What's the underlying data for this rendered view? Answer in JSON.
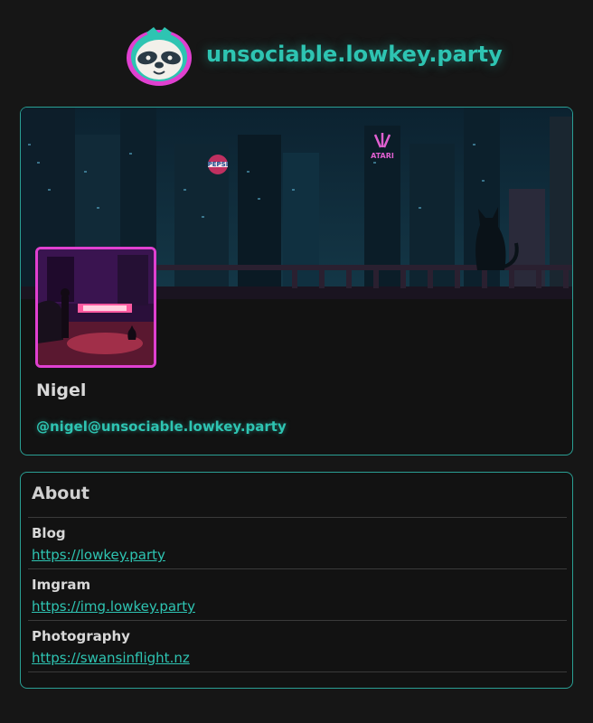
{
  "site": {
    "title": "unsociable.lowkey.party"
  },
  "profile": {
    "display_name": "Nigel",
    "handle": "@nigel@unsociable.lowkey.party",
    "banner_signs": {
      "pepsi": "PEPSI",
      "atari": "ATARI"
    }
  },
  "about": {
    "title": "About",
    "fields": [
      {
        "label": "Blog",
        "value": "https://lowkey.party"
      },
      {
        "label": "Imgram",
        "value": "https://img.lowkey.party"
      },
      {
        "label": "Photography",
        "value": "https://swansinflight.nz"
      }
    ]
  },
  "colors": {
    "accent": "#2ec4b2",
    "avatar_border": "#e040d0",
    "background": "#161616",
    "card_border": "#2a9f94"
  },
  "icons": {
    "logo": "sloth-mascot-icon"
  }
}
